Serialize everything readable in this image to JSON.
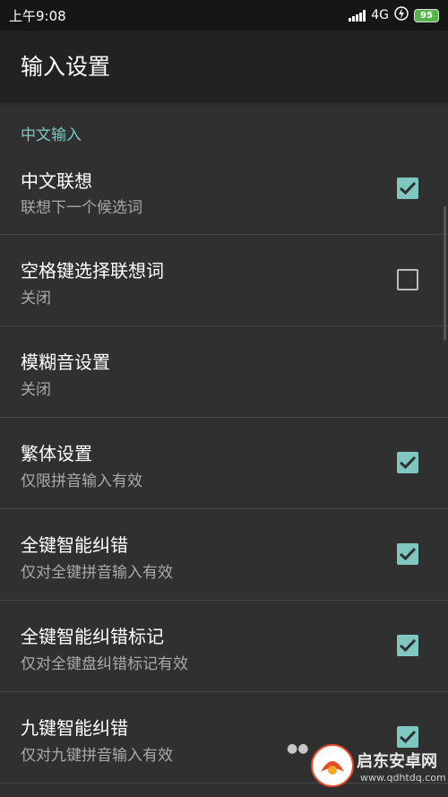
{
  "status_bar": {
    "time": "上午9:08",
    "network": "4G",
    "battery": "95"
  },
  "app_bar": {
    "title": "输入设置"
  },
  "section": {
    "header": "中文输入"
  },
  "preferences": [
    {
      "title": "中文联想",
      "summary": "联想下一个候选词",
      "checked": true
    },
    {
      "title": "空格键选择联想词",
      "summary": "关闭",
      "checked": false
    },
    {
      "title": "模糊音设置",
      "summary": "关闭",
      "checked": null
    },
    {
      "title": "繁体设置",
      "summary": "仅限拼音输入有效",
      "checked": true
    },
    {
      "title": "全键智能纠错",
      "summary": "仅对全键拼音输入有效",
      "checked": true
    },
    {
      "title": "全键智能纠错标记",
      "summary": "仅对全键盘纠错标记有效",
      "checked": true
    },
    {
      "title": "九键智能纠错",
      "summary": "仅对九键拼音输入有效",
      "checked": true
    }
  ],
  "colors": {
    "accent": "#7fc7c0",
    "background": "#303030",
    "app_bar": "#222222",
    "status_bar": "#161616",
    "battery": "#55b548"
  },
  "watermark": {
    "text": "启东安卓网",
    "sub": "www.qdhtdq.com"
  }
}
